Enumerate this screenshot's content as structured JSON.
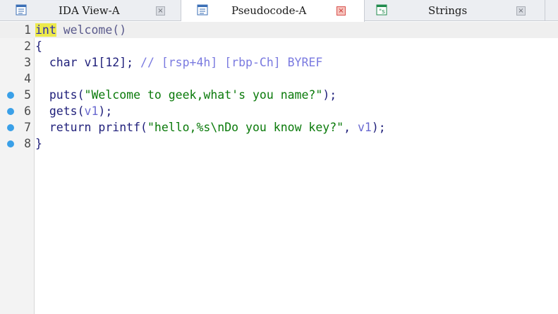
{
  "tabs": [
    {
      "label": "IDA View-A",
      "icon": "ida-view-icon",
      "active": false
    },
    {
      "label": "Pseudocode-A",
      "icon": "pseudocode-icon",
      "active": true
    },
    {
      "label": "Strings",
      "icon": "strings-icon",
      "active": false
    }
  ],
  "close_glyph": "×",
  "editor": {
    "lines": [
      {
        "n": "1",
        "breakpoint": false,
        "tokens": [
          [
            "int",
            "kw-hl"
          ],
          [
            " welcome()",
            "ident"
          ]
        ]
      },
      {
        "n": "2",
        "breakpoint": false,
        "tokens": [
          [
            "{",
            "plain"
          ]
        ]
      },
      {
        "n": "3",
        "breakpoint": false,
        "tokens": [
          [
            "  char v1[12]; ",
            "plain"
          ],
          [
            "// [rsp+4h] [rbp-Ch] BYREF",
            "cmt"
          ]
        ]
      },
      {
        "n": "4",
        "breakpoint": false,
        "tokens": []
      },
      {
        "n": "5",
        "breakpoint": true,
        "tokens": [
          [
            "  puts(",
            "plain"
          ],
          [
            "\"Welcome to geek,what's you name?\"",
            "str"
          ],
          [
            ");",
            "plain"
          ]
        ]
      },
      {
        "n": "6",
        "breakpoint": true,
        "tokens": [
          [
            "  gets(",
            "plain"
          ],
          [
            "v1",
            "var"
          ],
          [
            ");",
            "plain"
          ]
        ]
      },
      {
        "n": "7",
        "breakpoint": true,
        "tokens": [
          [
            "  return printf(",
            "plain"
          ],
          [
            "\"hello,%s\\nDo you know key?\"",
            "str"
          ],
          [
            ", ",
            "plain"
          ],
          [
            "v1",
            "var"
          ],
          [
            ");",
            "plain"
          ]
        ]
      },
      {
        "n": "8",
        "breakpoint": true,
        "tokens": [
          [
            "}",
            "plain"
          ]
        ]
      }
    ]
  },
  "colors": {
    "breakpoint": "#3aa0e8",
    "string": "#0a7a0a",
    "comment": "#7a7ae0",
    "highlight": "#ece94b"
  }
}
